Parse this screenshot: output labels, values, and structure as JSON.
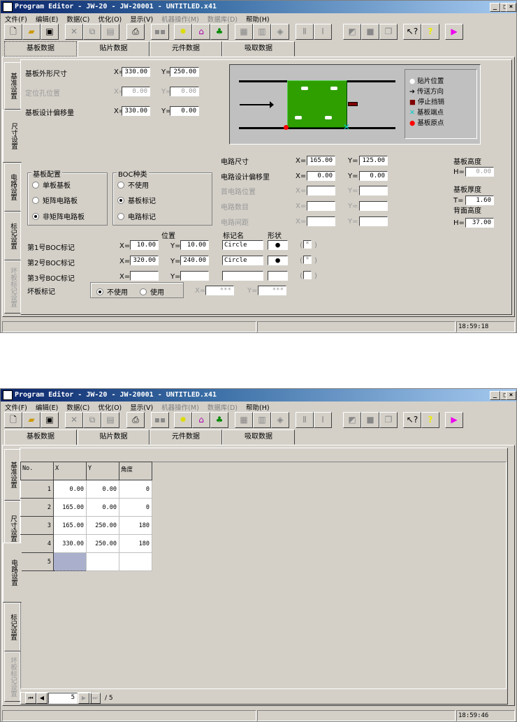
{
  "title": "Program Editor - JW-20 - JW-20001 - UNTITLED.x41",
  "window_buttons": {
    "min": "_",
    "max": "□",
    "close": "×"
  },
  "menu": [
    "文件(F)",
    "编辑(E)",
    "数据(C)",
    "优化(O)",
    "显示(V)",
    "机器操作(M)",
    "数据库(D)",
    "帮助(H)"
  ],
  "toolbar_icons": [
    "new-file",
    "open-folder",
    "save",
    "cut",
    "copy",
    "paste",
    "print",
    "find",
    "bulb",
    "optimize",
    "components",
    "grid-a",
    "grid-b",
    "box",
    "align-a",
    "align-b",
    "shape-a",
    "shape-b",
    "shape-c",
    "context-help",
    "help",
    "exit"
  ],
  "top_tabs": [
    "基板数据",
    "贴片数据",
    "元件数据",
    "吸取数据"
  ],
  "side_tabs": [
    "基准设置",
    "尺寸设置",
    "电路设置",
    "标记设置",
    "坏板标记设置"
  ],
  "screen1": {
    "board": {
      "outline": {
        "label": "基板外形尺寸",
        "x": "330.00",
        "y": "250.00"
      },
      "hole": {
        "label": "定位孔位置",
        "x": "0.00",
        "y": "0.00"
      },
      "offset": {
        "label": "基板设计偏移量",
        "x": "330.00",
        "y": "0.00"
      }
    },
    "legend": [
      "贴片位置",
      "传送方向",
      "停止挡销",
      "基板端点",
      "基板原点"
    ],
    "config": {
      "title": "基板配置",
      "options": [
        "单板基板",
        "矩阵电路板",
        "非矩阵电路板"
      ],
      "selected": 2
    },
    "boc_type": {
      "title": "BOC种类",
      "options": [
        "不使用",
        "基板标记",
        "电路标记"
      ],
      "selected": 1
    },
    "circuit": [
      {
        "label": "电路尺寸",
        "x": "165.00",
        "y": "125.00"
      },
      {
        "label": "电路设计偏移里",
        "x": "0.00",
        "y": "0.00"
      },
      {
        "label": "首电路位置",
        "x": "",
        "y": ""
      },
      {
        "label": "电路数目",
        "x": "",
        "y": ""
      },
      {
        "label": "电路间距",
        "x": "",
        "y": ""
      }
    ],
    "height": {
      "label": "基板高度",
      "prefix": "H=",
      "value": "0.00"
    },
    "thickness": {
      "label": "基板厚度",
      "prefix": "T=",
      "value": "1.60"
    },
    "back": {
      "label": "背面高度",
      "prefix": "H=",
      "value": "37.00"
    },
    "marks_headers": {
      "pos": "位置",
      "name": "标记名",
      "shape": "形状"
    },
    "marks": [
      {
        "label": "第1号BOC标记",
        "x": "10.00",
        "y": "10.00",
        "name": "Circle",
        "check": "*"
      },
      {
        "label": "第2号BOC标记",
        "x": "320.00",
        "y": "240.00",
        "name": "Circle",
        "check": "*"
      },
      {
        "label": "第3号BOC标记",
        "x": "",
        "y": "",
        "name": "",
        "check": ""
      }
    ],
    "bad": {
      "label": "坏板标记",
      "options": [
        "不使用",
        "使用"
      ],
      "selected": 0,
      "x": "***",
      "y": "***"
    },
    "time": "18:59:18"
  },
  "labels": {
    "x": "X=",
    "y": "Y=",
    "lp": "(",
    "rp": ")"
  },
  "screen2": {
    "headers": [
      "No.",
      "X",
      "Y",
      "角度"
    ],
    "rows": [
      [
        "1",
        "0.00",
        "0.00",
        "0"
      ],
      [
        "2",
        "165.00",
        "0.00",
        "0"
      ],
      [
        "3",
        "165.00",
        "250.00",
        "180"
      ],
      [
        "4",
        "330.00",
        "250.00",
        "180"
      ],
      [
        "5",
        "",
        "",
        ""
      ]
    ],
    "page": "5",
    "total": "/ 5",
    "time": "18:59:46"
  }
}
